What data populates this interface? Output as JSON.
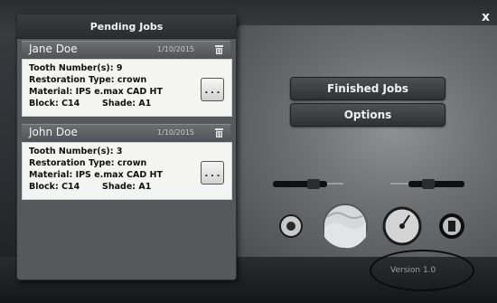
{
  "window": {
    "close_glyph": "x"
  },
  "pending_panel": {
    "title": "Pending Jobs",
    "jobs": [
      {
        "name": "Jane Doe",
        "date": "1/10/2015",
        "tooth": "Tooth Number(s): 9",
        "restoration": "Restoration Type: crown",
        "material": "Material: IPS e.max CAD HT",
        "block": "Block: C14",
        "shade": "Shade: A1",
        "more_label": "..."
      },
      {
        "name": "John Doe",
        "date": "1/10/2015",
        "tooth": "Tooth Number(s): 3",
        "restoration": "Restoration Type: crown",
        "material": "Material: IPS e.max CAD HT",
        "block": "Block: C14",
        "shade": "Shade: A1",
        "more_label": "..."
      }
    ]
  },
  "menu": {
    "finished_jobs": "Finished Jobs",
    "options": "Options"
  },
  "tools": {
    "left_tool_icon": "mill-tool-icon",
    "right_tool_icon": "mill-tool-icon",
    "status_icons": [
      "settings-knob-icon",
      "water-tank-icon",
      "pressure-gauge-icon",
      "spindle-icon"
    ]
  },
  "footer": {
    "version": "Version 1.0"
  },
  "colors": {
    "panel": "#55595c",
    "card": "#f4f4f2",
    "accent": "#e8e8e8"
  }
}
